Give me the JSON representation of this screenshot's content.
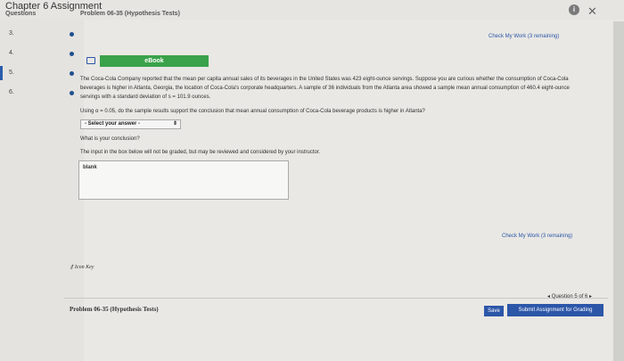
{
  "window": {
    "title": "Chapter 6 Assignment",
    "tab1": "Questions",
    "tab2": "Problem 06-35 (Hypothesis Tests)",
    "info_icon": "i"
  },
  "sidebar": {
    "items": [
      {
        "num": "3."
      },
      {
        "num": "4."
      },
      {
        "num": "5."
      },
      {
        "num": "6."
      }
    ]
  },
  "main": {
    "check_top": "Check My Work (3 remaining)",
    "ebook_label": "eBook",
    "problem_text": "The Coca-Cola Company reported that the mean per capita annual sales of its beverages in the United States was 423 eight-ounce servings. Suppose you are curious whether the consumption of Coca-Cola beverages is higher in Atlanta, Georgia, the location of Coca-Cola's corporate headquarters. A sample of 36 individuals from the Atlanta area showed a sample mean annual consumption of 460.4 eight-ounce servings with a standard deviation of s = 101.9 ounces.",
    "question_text": "Using α = 0.05, do the sample results support the conclusion that mean annual consumption of Coca-Cola beverage products is higher in Atlanta?",
    "select_value": "- Select your answer -",
    "conclusion_prompt": "What is your conclusion?",
    "box_note": "The input in the box below will not be graded, but may be reviewed and considered by your instructor.",
    "textarea_value": "blank",
    "check_bottom": "Check My Work (3 remaining)",
    "icon_key": "Icon Key"
  },
  "footer": {
    "pager": "◂ Question 5 of 6 ▸",
    "problem_title": "Problem 06-35 (Hypothesis Tests)",
    "save_label": "Save",
    "submit_label": "Submit Assignment for Grading"
  },
  "colors": {
    "accent": "#2c56a8",
    "ebook": "#3aa24a"
  }
}
